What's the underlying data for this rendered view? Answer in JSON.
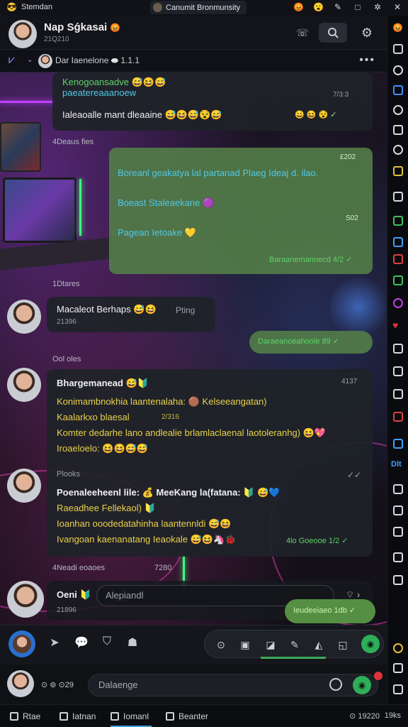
{
  "status_bar": {
    "app_title": "Stemdan",
    "window_title": "Canumit Bronmunsity"
  },
  "header": {
    "name": "Nap Sǵkasai",
    "subtitle": "21Q210"
  },
  "sub_header": {
    "text": "Dar Iaenelone",
    "count": "1.1.1",
    "more": "•••"
  },
  "messages": {
    "m1": {
      "line1": "Kenogoansadve 😅😆😅",
      "line2": "paeatereaaanoew",
      "time": "7/3:3",
      "line3": "Ialeaoalle mant dleaaine 😅😆😅😵😅",
      "status": "😀 😆 😵 ✓"
    },
    "sep1": "4Deaus fies",
    "m2": {
      "line1": "Boreanl geakatya lal partanad Plaeg Ideaj d. ilao.",
      "time1": "£202",
      "line2": "Boeast Staleaekane 🟣",
      "time2": "S02",
      "line3": "Pagean Ietoake 💛",
      "footer": "Baraanemannecd 4/2 ✓"
    },
    "sep2": "1Dtares",
    "m3": {
      "name": "Macaleot Berhaps 😅😆",
      "tag": "Pting",
      "time": "21396"
    },
    "m4": {
      "text": "Daraeanoeahoole 89 ✓"
    },
    "sep3": "Ool oles",
    "m5": {
      "name": "Bhargemanead 😅🔰",
      "time": "4137",
      "line1": "Konimambnokhia laantenalaha: 🟤 Kelseeangatan)",
      "line2": "Kaalarkxo blaesal",
      "line2b": "2/316",
      "line3": "Komter dedarhe lano andlealie brlamlaclaenal laotoleranhg) 😆💖",
      "line4": "Iroaeloelo: 😆😆😅😅"
    },
    "sep4": "Plooks",
    "m6": {
      "line1": "Poenaleeheenl lile: 💰 MeeKang la(fatana: 🔰 😅💙",
      "line2": "Raeadhee Fellekaol) 🔰",
      "line3": "Ioanhan ooodedatahinha laantennldi 😅😆",
      "line4": "Ivangoan kaenanatang Ieaokale 😅😆🦄🐞",
      "footer": "4lo Goeooe 1/2 ✓"
    },
    "sep5": "4Neadi eoaoes",
    "sep5_time": "7280",
    "m7": {
      "name": "Oeni 🔰",
      "time": "21896",
      "input_placeholder": "Alepiandl",
      "out_text": "Ieudeeiaeo 1db ✓"
    }
  },
  "toolbar": {
    "send_icon": "send-icon"
  },
  "compose": {
    "mini_label": "⊙ ⊚ ⊙29",
    "placeholder": "Dalaenge"
  },
  "bottom_tabs": {
    "tab1": "Rtae",
    "tab2": "Iatnan",
    "tab3": "Iomanl",
    "tab4": "Beanter",
    "clock": "19220",
    "right_label": "19ks"
  },
  "colors": {
    "bubble_in": "#1e2228",
    "bubble_out": "#548048",
    "accent_green": "#2fae5a",
    "accent_blue": "#3fa0e0"
  }
}
